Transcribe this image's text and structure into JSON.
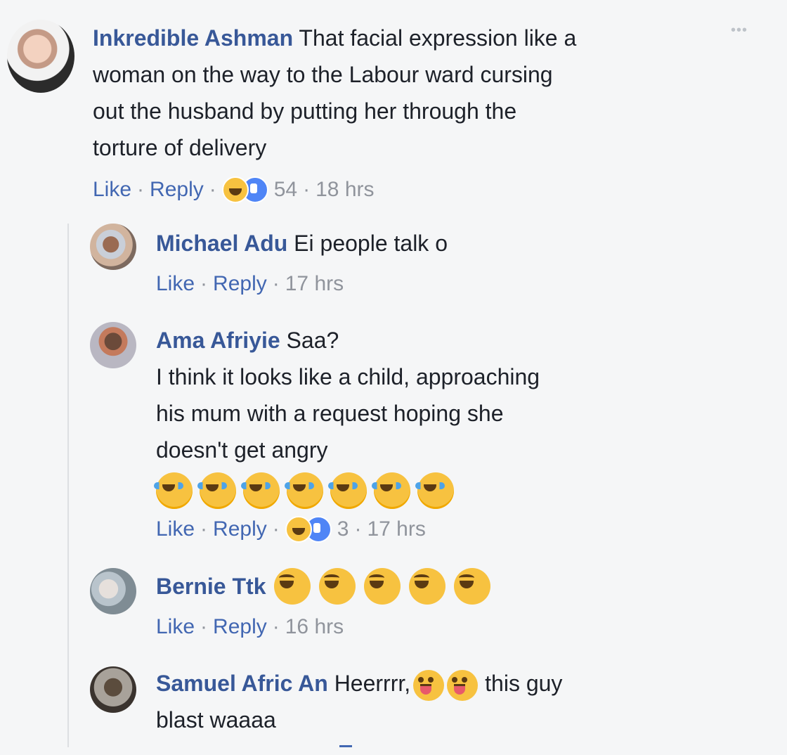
{
  "more_icon": "more-options-icon",
  "comments": [
    {
      "author": "Inkredible Ashman",
      "lines": [
        "That facial expression like a",
        "woman on the way to the Labour ward cursing",
        "out the husband by putting her through the",
        "torture of delivery"
      ],
      "like": "Like",
      "reply": "Reply",
      "reaction_count": "54",
      "time": "18 hrs"
    },
    {
      "author": "Michael Adu",
      "lines": [
        "Ei people talk o"
      ],
      "like": "Like",
      "reply": "Reply",
      "time": "17 hrs"
    },
    {
      "author": "Ama Afriyie",
      "lines": [
        "Saa?",
        "I think it looks like a child, approaching",
        "his mum with a request hoping she",
        "doesn't get angry"
      ],
      "emoji_row": [
        "face-with-tears-of-joy",
        "face-with-tears-of-joy",
        "face-with-tears-of-joy",
        "face-with-tears-of-joy",
        "face-with-tears-of-joy",
        "face-with-tears-of-joy",
        "face-with-tears-of-joy"
      ],
      "like": "Like",
      "reply": "Reply",
      "reaction_count": "3",
      "time": "17 hrs"
    },
    {
      "author": "Bernie Ttk",
      "emoji_row": [
        "grinning-squinting-face",
        "grinning-squinting-face",
        "grinning-squinting-face",
        "grinning-squinting-face",
        "grinning-squinting-face"
      ],
      "like": "Like",
      "reply": "Reply",
      "time": "16 hrs"
    },
    {
      "author": "Samuel Afric An",
      "lines": [
        "Heerrrr,",
        "this guy",
        "blast waaaa"
      ],
      "emoji_inline": [
        "winking-face-with-tongue",
        "winking-face-with-tongue"
      ]
    }
  ],
  "colors": {
    "background": "#f5f6f7",
    "name": "#385898",
    "link": "#4267b2",
    "meta": "#90949c"
  }
}
